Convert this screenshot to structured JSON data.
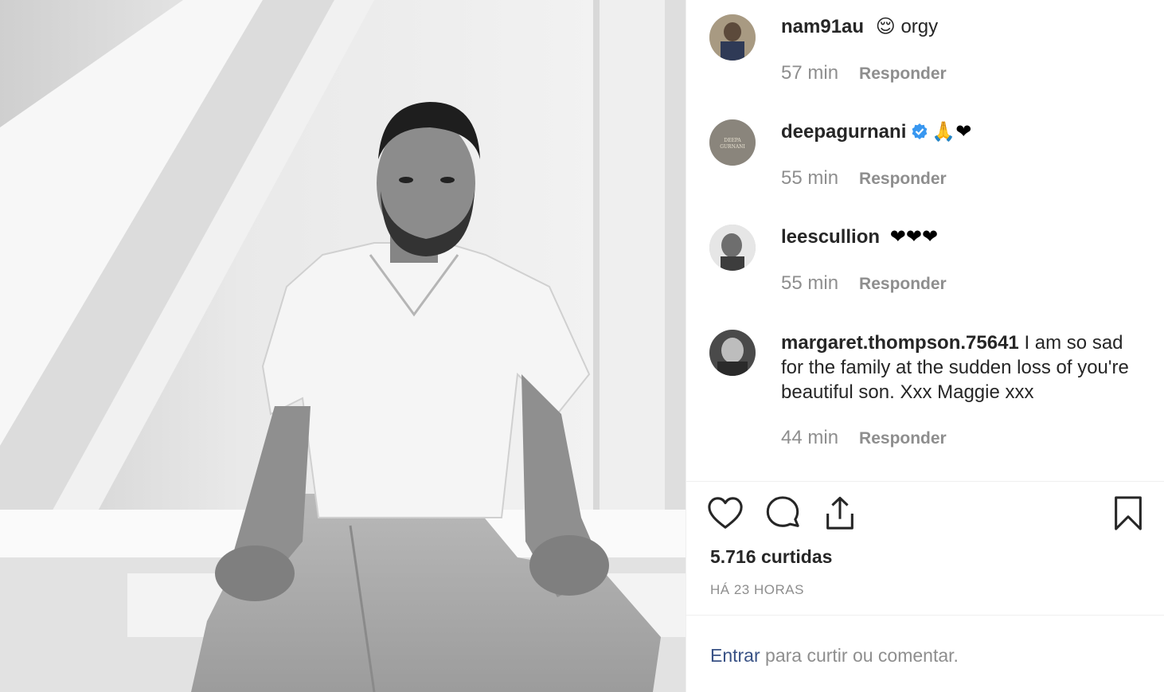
{
  "post": {
    "comments": [
      {
        "username": "nam91au",
        "emoji": "😌",
        "text": "orgy",
        "verified": false,
        "time": "57 min",
        "reply": "Responder"
      },
      {
        "username": "deepagurnani",
        "text": "🙏❤",
        "verified": true,
        "time": "55 min",
        "reply": "Responder"
      },
      {
        "username": "leescullion",
        "text": "❤❤❤",
        "verified": false,
        "time": "55 min",
        "reply": "Responder"
      },
      {
        "username": "margaret.thompson.75641",
        "text": "I am so sad for the family at the sudden loss of you're beautiful son. Xxx Maggie xxx",
        "verified": false,
        "time": "44 min",
        "reply": "Responder"
      }
    ],
    "likes": "5.716 curtidas",
    "posted": "HÁ 23 HORAS",
    "login_link": "Entrar",
    "login_rest": " para curtir ou comentar."
  },
  "icons": [
    "heart-icon",
    "comment-icon",
    "share-icon",
    "bookmark-icon",
    "verified-badge-icon"
  ],
  "colors": {
    "accent_link": "#385185",
    "verified": "#3897f0",
    "muted": "#8e8e8e",
    "text": "#262626"
  }
}
